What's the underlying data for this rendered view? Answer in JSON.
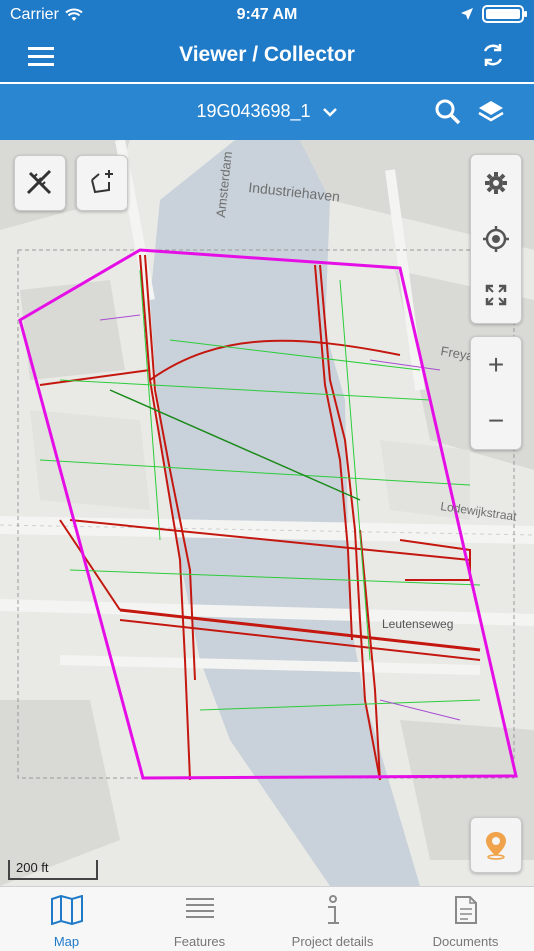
{
  "status": {
    "carrier": "Carrier",
    "time": "9:47 AM"
  },
  "nav": {
    "title": "Viewer / Collector"
  },
  "project": {
    "id": "19G043698_1"
  },
  "map": {
    "labels": [
      "Amsterdam",
      "Industriehaven",
      "Freya",
      "Lodewijkstraat",
      "Leutenseweg"
    ],
    "scale_label": "200 ft"
  },
  "map_controls": {
    "zoom_in": "+",
    "zoom_out": "−"
  },
  "tabs": [
    {
      "label": "Map",
      "icon": "map-icon",
      "active": true
    },
    {
      "label": "Features",
      "icon": "list-icon",
      "active": false
    },
    {
      "label": "Project details",
      "icon": "info-icon",
      "active": false
    },
    {
      "label": "Documents",
      "icon": "document-icon",
      "active": false
    }
  ],
  "colors": {
    "header": "#1f7ac8",
    "subheader": "#2a86d1",
    "boundary": "#e60ee6",
    "utility_red": "#c4170f",
    "utility_green": "#2ccc3a",
    "water": "#c9d2da",
    "gps_pin": "#f0a34a"
  }
}
